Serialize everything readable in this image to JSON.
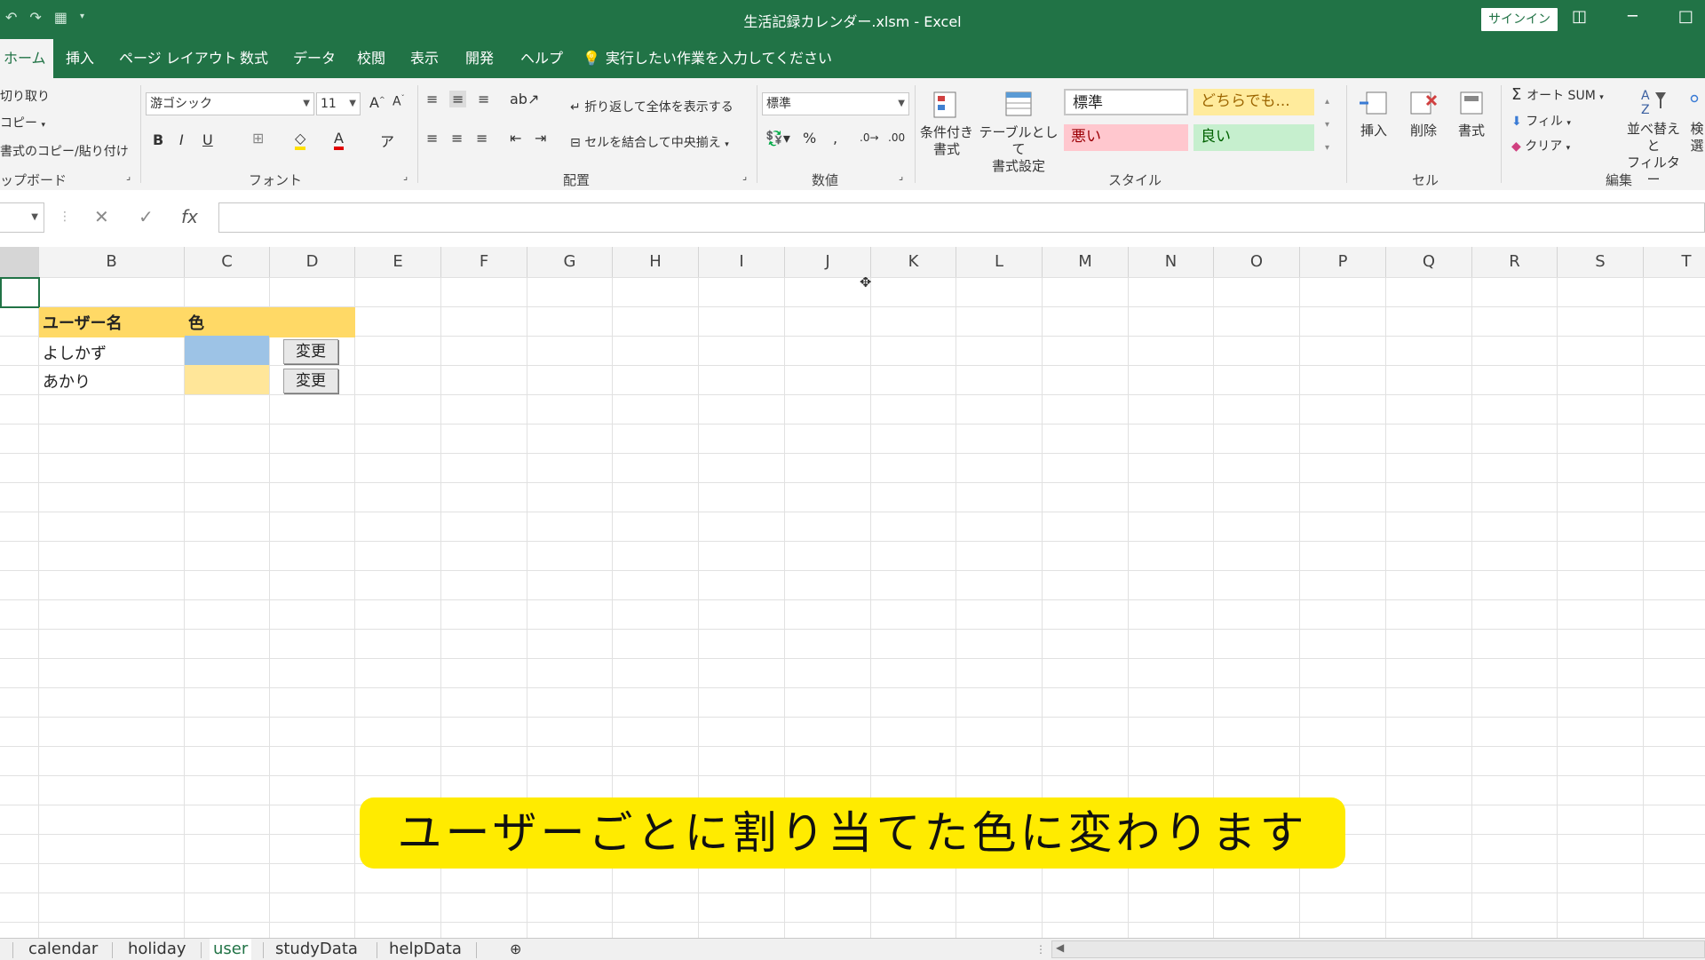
{
  "window": {
    "title": "生活記録カレンダー.xlsm  -  Excel",
    "signin_label": "サインイン"
  },
  "menu": {
    "tabs": [
      "ホーム",
      "挿入",
      "ページ レイアウト",
      "数式",
      "データ",
      "校閲",
      "表示",
      "開発",
      "ヘルプ"
    ],
    "tell_me": "実行したい作業を入力してください"
  },
  "ribbon": {
    "clipboard": {
      "cut": "切り取り",
      "copy": "コピー",
      "format_painter": "書式のコピー/貼り付け",
      "group": "ップボード"
    },
    "font": {
      "name": "游ゴシック",
      "size": "11",
      "group": "フォント"
    },
    "alignment": {
      "wrap": "折り返して全体を表示する",
      "merge": "セルを結合して中央揃え",
      "group": "配置"
    },
    "number": {
      "format": "標準",
      "group": "数値"
    },
    "styles": {
      "conditional": "条件付き\n書式",
      "table": "テーブルとして\n書式設定",
      "normal": "標準",
      "neutral": "どちらでも...",
      "bad": "悪い",
      "good": "良い",
      "group": "スタイル"
    },
    "cells": {
      "insert": "挿入",
      "delete": "削除",
      "format": "書式",
      "group": "セル"
    },
    "editing": {
      "autosum": "オート SUM",
      "fill": "フィル",
      "clear": "クリア",
      "sort": "並べ替えと\nフィルター",
      "find": "検\n選",
      "group": "編集"
    }
  },
  "formula_bar": {
    "fx": "fx"
  },
  "columns": [
    "B",
    "C",
    "D",
    "E",
    "F",
    "G",
    "H",
    "I",
    "J",
    "K",
    "L",
    "M",
    "N",
    "O",
    "P",
    "Q",
    "R",
    "S",
    "T"
  ],
  "sheet": {
    "header": {
      "user": "ユーザー名",
      "color": "色"
    },
    "rows": [
      {
        "name": "よしかず",
        "color": "#9dc3e6",
        "button": "変更"
      },
      {
        "name": "あかり",
        "color": "#ffe699",
        "button": "変更"
      }
    ],
    "header_fill": "#ffd966"
  },
  "subtitle": "ユーザーごとに割り当てた色に変わります",
  "sheet_tabs": [
    "calendar",
    "holiday",
    "user",
    "studyData",
    "helpData"
  ],
  "active_sheet": "user",
  "colors": {
    "excel_green": "#217346"
  }
}
